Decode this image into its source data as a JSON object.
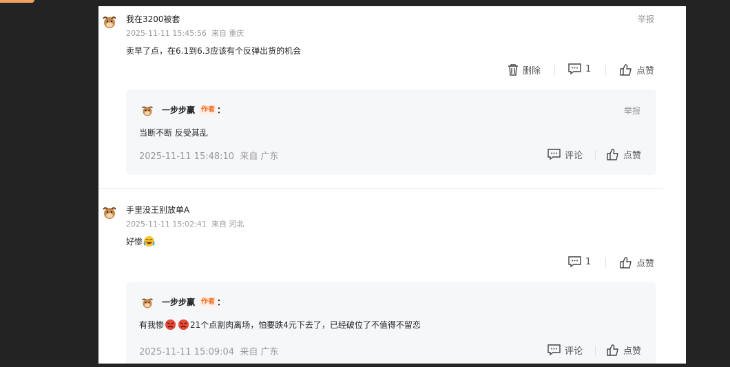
{
  "comments": [
    {
      "username": "我在3200被套",
      "timestamp": "2025-11-11 15:45:56",
      "location": "来自 重庆",
      "text": "卖早了点，在6.1到6.3应该有个反弹出货的机会",
      "report_label": "举报",
      "delete_label": "删除",
      "reply_count": "1",
      "like_label": "点赞",
      "reply": {
        "username": "一步步赢",
        "author_badge": "作者",
        "colon": "：",
        "text": "当断不断 反受其乱",
        "timestamp": "2025-11-11 15:48:10",
        "location": "来自 广东",
        "report_label": "举报",
        "comment_label": "评论",
        "like_label": "点赞"
      }
    },
    {
      "username": "手里没王别放单A",
      "timestamp": "2025-11-11 15:02:41",
      "location": "来自 河北",
      "text": "好惨",
      "reply_count": "1",
      "like_label": "点赞",
      "reply": {
        "username": "一步步赢",
        "author_badge": "作者",
        "colon": "：",
        "text_prefix": "有我惨",
        "text_suffix": "21个点割肉离场，怕要跌4元下去了，已经破位了不值得不留恋",
        "timestamp": "2025-11-11 15:09:04",
        "location": "来自 广东",
        "comment_label": "评论",
        "like_label": "点赞"
      }
    }
  ],
  "colors": {
    "page_bg": "#232323",
    "panel_bg": "#ffffff",
    "reply_bg": "#f6f7f9",
    "author_badge": "#f06a21",
    "muted": "#999999"
  },
  "icons": [
    "cow-avatar-icon",
    "trash-icon",
    "comment-bubble-icon",
    "thumbs-up-icon",
    "laughing-crying-emoji",
    "angry-emoji"
  ]
}
